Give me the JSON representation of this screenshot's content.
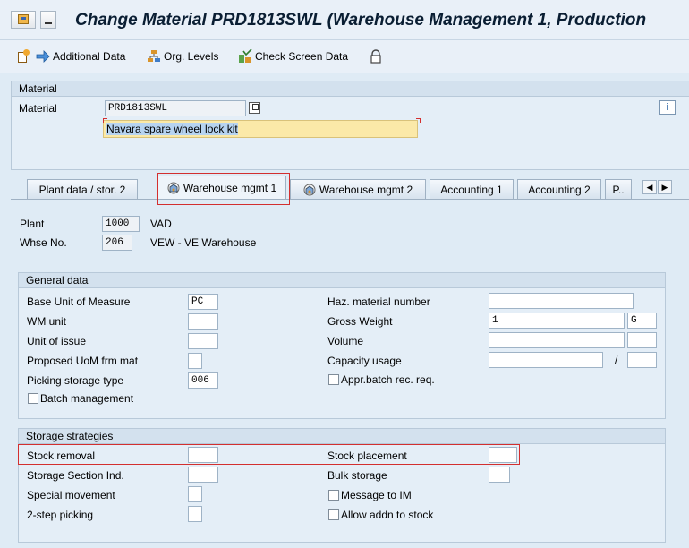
{
  "title": "Change Material PRD1813SWL (Warehouse Management 1, Production",
  "toolbar": {
    "additional_data": "Additional Data",
    "org_levels": "Org. Levels",
    "check_screen_data": "Check Screen Data"
  },
  "material_section": {
    "heading": "Material",
    "material_label": "Material",
    "material_value": "PRD1813SWL",
    "description_value": "Navara spare wheel lock kit"
  },
  "tabs": [
    {
      "label": "Plant data / stor. 2",
      "active": false
    },
    {
      "label": "Warehouse mgmt 1",
      "active": true
    },
    {
      "label": "Warehouse mgmt 2",
      "active": false
    },
    {
      "label": "Accounting 1",
      "active": false
    },
    {
      "label": "Accounting 2",
      "active": false
    },
    {
      "label": "P..",
      "active": false
    }
  ],
  "org": {
    "plant_label": "Plant",
    "plant_value": "1000",
    "plant_name": "VAD",
    "whse_label": "Whse No.",
    "whse_value": "206",
    "whse_name": "VEW - VE Warehouse"
  },
  "general_data": {
    "heading": "General data",
    "base_uom_label": "Base Unit of Measure",
    "base_uom_value": "PC",
    "wm_unit_label": "WM unit",
    "wm_unit_value": "",
    "unit_of_issue_label": "Unit of issue",
    "unit_of_issue_value": "",
    "proposed_uom_label": "Proposed UoM frm mat",
    "proposed_uom_value": "",
    "picking_storage_type_label": "Picking storage type",
    "picking_storage_type_value": "006",
    "batch_management_label": "Batch management",
    "haz_material_label": "Haz. material number",
    "haz_material_value": "",
    "gross_weight_label": "Gross Weight",
    "gross_weight_value": "1",
    "gross_weight_unit": "G",
    "volume_label": "Volume",
    "volume_value": "",
    "capacity_usage_label": "Capacity usage",
    "capacity_usage_value": "",
    "capacity_separator": "/",
    "appr_batch_label": "Appr.batch rec. req."
  },
  "storage_strategies": {
    "heading": "Storage strategies",
    "stock_removal_label": "Stock removal",
    "stock_removal_value": "",
    "storage_section_label": "Storage Section Ind.",
    "storage_section_value": "",
    "special_movement_label": "Special movement",
    "special_movement_value": "",
    "two_step_picking_label": "2-step picking",
    "two_step_picking_value": "",
    "stock_placement_label": "Stock placement",
    "stock_placement_value": "",
    "bulk_storage_label": "Bulk storage",
    "bulk_storage_value": "",
    "message_to_im_label": "Message to IM",
    "allow_addn_label": "Allow addn to stock"
  }
}
